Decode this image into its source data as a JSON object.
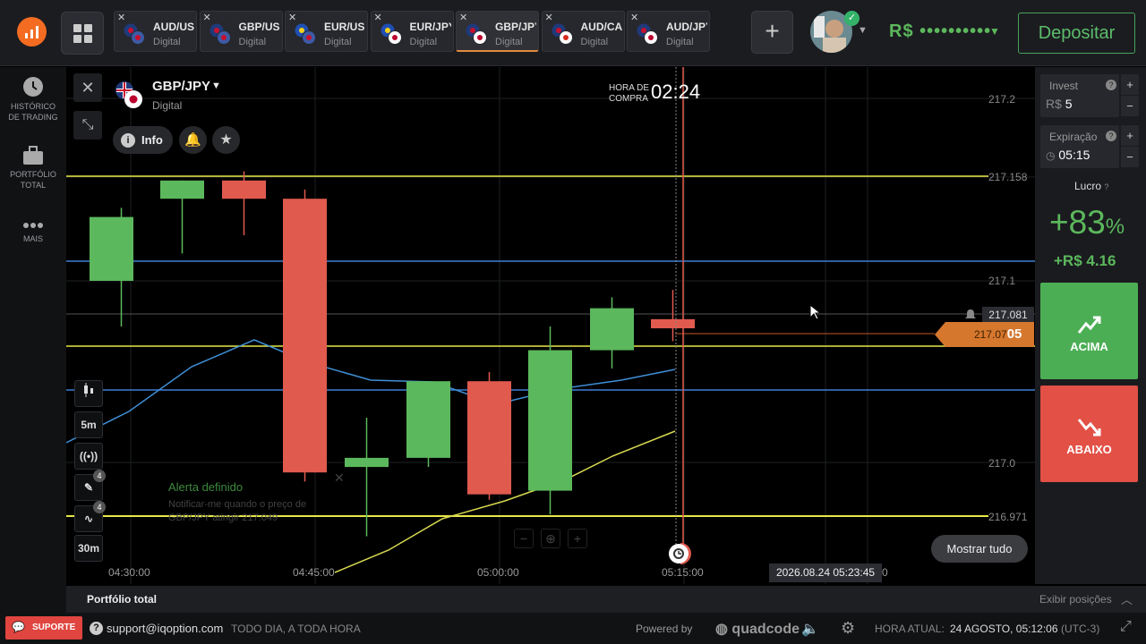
{
  "tabs": [
    {
      "pair": "AUD/USD",
      "kind": "Digital",
      "flag": "au-us"
    },
    {
      "pair": "GBP/USD",
      "kind": "Digital",
      "flag": "gb-us"
    },
    {
      "pair": "EUR/USD",
      "kind": "Digital",
      "flag": "eu-us"
    },
    {
      "pair": "EUR/JPY",
      "kind": "Digital",
      "flag": "eu-jp"
    },
    {
      "pair": "GBP/JPY",
      "kind": "Digital",
      "flag": "gb-jp",
      "active": true
    },
    {
      "pair": "AUD/CAD",
      "kind": "Digital",
      "flag": "au-ca"
    },
    {
      "pair": "AUD/JPY",
      "kind": "Digital",
      "flag": "au-jp"
    }
  ],
  "header": {
    "balance": "R$ ••••••••••",
    "deposit_label": "Depositar",
    "add_tab": "+"
  },
  "nav": {
    "history": "HISTÓRICO DE TRADING",
    "history_l1": "HISTÓRICO",
    "history_l2": "DE TRADING",
    "portfolio_l1": "PORTFÓLIO",
    "portfolio_l2": "TOTAL",
    "more": "MAIS"
  },
  "asset": {
    "name": "GBP/JPY",
    "kind": "Digital",
    "info_label": "Info"
  },
  "buy_time": {
    "label_l1": "HORA DE",
    "label_l2": "COMPRA",
    "value": "02:24"
  },
  "price_axis": {
    "p1": "217.2",
    "p2": "217.158",
    "p3": "217.1",
    "p4": "217.0",
    "p5": "216.971",
    "current": "217.081",
    "tag_main": "217.07",
    "tag_bold": "05"
  },
  "tools": {
    "timeframe": "5m",
    "candle_time": "30m",
    "badge_draw": "4",
    "badge_ind": "4"
  },
  "alert": {
    "title": "Alerta definido",
    "text": "Notificar-me quando o preço de GBP/JPY atingir 217.049"
  },
  "time_axis": {
    "t1": "04:30:00",
    "t2": "04:45:00",
    "t3": "05:00:00",
    "t4": "05:15:00",
    "cursor_date": "2026.08.24 05:23:45",
    "t5": "0"
  },
  "show_all": "Mostrar tudo",
  "panel": {
    "invest_label": "Invest",
    "invest_value": "5",
    "invest_currency": "R$",
    "expiry_label": "Expiração",
    "expiry_value": "05:15",
    "profit_label": "Lucro",
    "profit_pct": "+83",
    "profit_pct_sign": "%",
    "profit_value": "+R$ 4.16",
    "up_label": "ACIMA",
    "down_label": "ABAIXO"
  },
  "portfolio": {
    "label": "Portfólio total",
    "positions": "Exibir posições"
  },
  "footer": {
    "support": "SUPORTE",
    "email": "support@iqoption.com",
    "hours": "TODO DIA, A TODA HORA",
    "powered": "Powered by",
    "brand": "quadcode",
    "clock_label": "HORA ATUAL:",
    "clock_value": "24 AGOSTO, 05:12:06",
    "clock_tz": "(UTC-3)"
  },
  "candles": [
    {
      "o": 217.1,
      "h": 217.14,
      "l": 217.075,
      "c": 217.135,
      "dir": "up"
    },
    {
      "o": 217.145,
      "h": 217.155,
      "l": 217.115,
      "c": 217.155,
      "dir": "up"
    },
    {
      "o": 217.155,
      "h": 217.16,
      "l": 217.125,
      "c": 217.145,
      "dir": "down"
    },
    {
      "o": 217.145,
      "h": 217.15,
      "l": 216.99,
      "c": 216.995,
      "dir": "down"
    },
    {
      "o": 216.998,
      "h": 217.025,
      "l": 216.96,
      "c": 217.003,
      "dir": "up"
    },
    {
      "o": 217.003,
      "h": 217.045,
      "l": 216.998,
      "c": 217.045,
      "dir": "up"
    },
    {
      "o": 217.045,
      "h": 217.05,
      "l": 216.98,
      "c": 216.983,
      "dir": "down"
    },
    {
      "o": 216.985,
      "h": 217.075,
      "l": 216.972,
      "c": 217.062,
      "dir": "up"
    },
    {
      "o": 217.062,
      "h": 217.091,
      "l": 217.052,
      "c": 217.085,
      "dir": "up"
    },
    {
      "o": 217.079,
      "h": 217.095,
      "l": 217.067,
      "c": 217.074,
      "dir": "down"
    }
  ],
  "colors": {
    "up": "#5cb85c",
    "down": "#e05a4e",
    "accent": "#f36c21",
    "blue_line": "#3f7fd6",
    "yellow_line": "#e8e84a"
  }
}
